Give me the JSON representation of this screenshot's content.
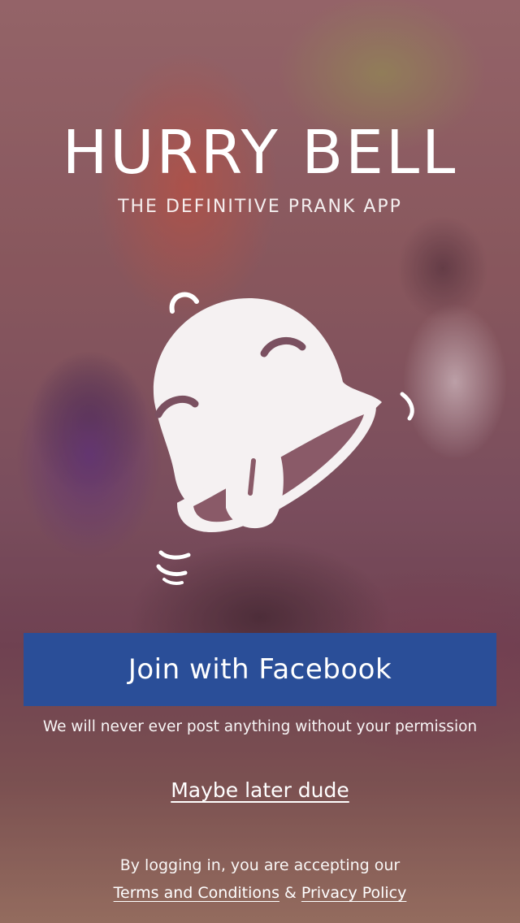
{
  "header": {
    "title": "HURRY BELL",
    "subtitle": "THE DEFINITIVE PRANK APP"
  },
  "logo": {
    "icon": "bell-mascot-icon"
  },
  "login": {
    "facebook_button_label": "Join with Facebook",
    "facebook_button_color": "#2a4e98",
    "notice": "We will never ever post anything without your permission",
    "skip_link": "Maybe later dude"
  },
  "legal": {
    "prefix": "By logging in, you are accepting our",
    "terms_link": "Terms and Conditions",
    "separator": "&",
    "privacy_link": "Privacy Policy"
  }
}
